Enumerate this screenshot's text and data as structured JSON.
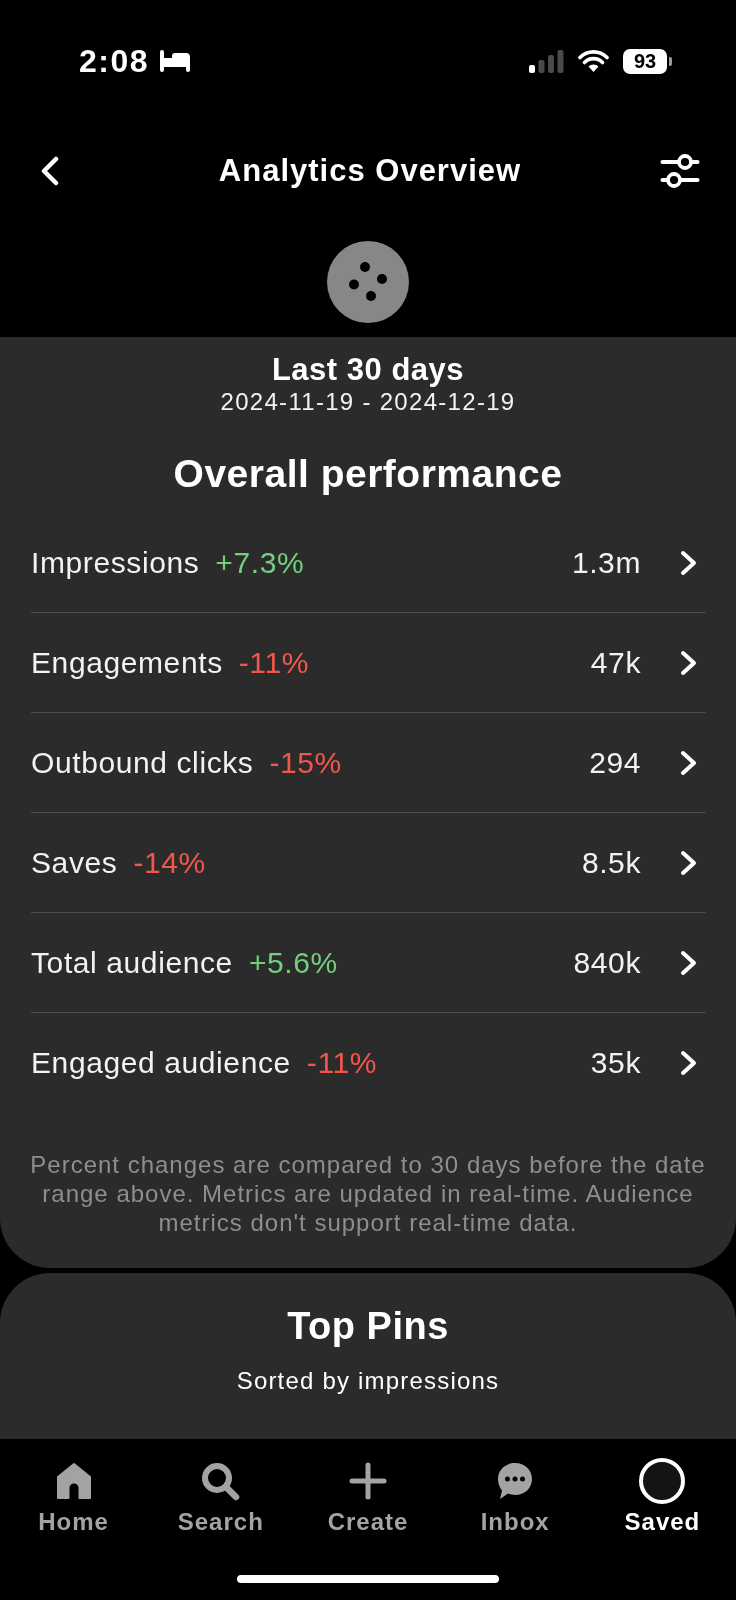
{
  "status_bar": {
    "time": "2:08",
    "battery": "93"
  },
  "header": {
    "title": "Analytics Overview"
  },
  "date_range": {
    "title": "Last 30 days",
    "range": "2024-11-19 - 2024-12-19"
  },
  "performance": {
    "title": "Overall performance",
    "metrics": [
      {
        "name": "Impressions",
        "change": "+7.3%",
        "color": "#72d07d",
        "value": "1.3m"
      },
      {
        "name": "Engagements",
        "change": "-11%",
        "color": "#f2564c",
        "value": "47k"
      },
      {
        "name": "Outbound clicks",
        "change": "-15%",
        "color": "#f2564c",
        "value": "294"
      },
      {
        "name": "Saves",
        "change": "-14%",
        "color": "#f2564c",
        "value": "8.5k"
      },
      {
        "name": "Total audience",
        "change": "+5.6%",
        "color": "#72d07d",
        "value": "840k"
      },
      {
        "name": "Engaged audience",
        "change": "-11%",
        "color": "#f2564c",
        "value": "35k"
      }
    ],
    "note": "Percent changes are compared to 30 days before the date range above. Metrics are updated in real-time. Audience metrics don't support real-time data."
  },
  "top_pins": {
    "title": "Top Pins",
    "subtitle": "Sorted by impressions"
  },
  "tab_bar": {
    "tabs": [
      {
        "kind": "home",
        "label": "Home",
        "selected": false
      },
      {
        "kind": "search",
        "label": "Search",
        "selected": false
      },
      {
        "kind": "create",
        "label": "Create",
        "selected": false
      },
      {
        "kind": "inbox",
        "label": "Inbox",
        "selected": false
      },
      {
        "kind": "profile",
        "label": "Saved",
        "selected": true
      }
    ]
  }
}
